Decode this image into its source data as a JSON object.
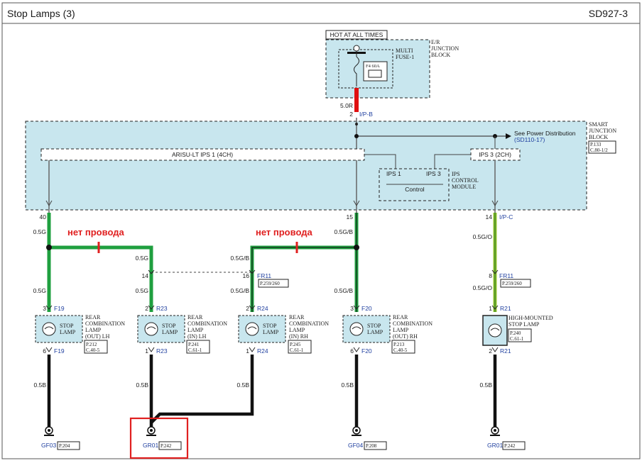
{
  "header": {
    "title": "Stop Lamps (3)",
    "code": "SD927-3"
  },
  "er_block": {
    "hot_label": "HOT AT ALL TIMES",
    "fuse_label_1": "MULTI",
    "fuse_label_2": "FUSE-1",
    "fuse_rating": "F4 60A",
    "name_1": "E/R",
    "name_2": "JUNCTION",
    "name_3": "BLOCK"
  },
  "feed": {
    "wire": "5.0R",
    "pin": "2",
    "conn": "I/P-B"
  },
  "sjb": {
    "name_1": "SMART",
    "name_2": "JUNCTION",
    "name_3": "BLOCK",
    "page_1": "P.133",
    "page_2": "C.80-1/2",
    "see_power": "See Power Distribution",
    "see_ref": "(SD110-17)",
    "ips1_4ch": "ARISU-LT IPS 1  (4CH)",
    "ips3_2ch": "IPS 3  (2CH)",
    "ips_1": "IPS 1",
    "ips_3": "IPS 3",
    "control": "Control",
    "module_1": "IPS",
    "module_2": "CONTROL",
    "module_3": "MODULE"
  },
  "wires": {
    "pin_40": "40",
    "w_05g": "0.5G",
    "pin_15": "15",
    "w_05gb": "0.5G/B",
    "pin_14": "14",
    "conn_ipc": "I/P-C",
    "w_05go": "0.5G/O",
    "jp_14": "14",
    "jp_16": "16",
    "fr11_a": "FR11",
    "fr11_a_page": "P.259/260",
    "w_05g_2": "0.5G",
    "w_05gb_2": "0.5G/B",
    "jp_8": "8",
    "fr11_b": "FR11",
    "fr11_b_page": "P.259/260",
    "w_05go_2": "0.5G/O",
    "w_05g_3": "0.5G",
    "w_05g_4": "0.5G",
    "w_05gb_3": "0.5G/B",
    "w_05gb_4": "0.5G/B",
    "no_wire_1": "нет провода",
    "no_wire_2": "нет провода"
  },
  "lamps": [
    {
      "pin_top": "3",
      "conn_top": "F19",
      "label_1": "STOP",
      "label_2": "LAMP",
      "name_1": "REAR",
      "name_2": "COMBINATION",
      "name_3": "LAMP",
      "name_4": "(OUT) LH",
      "page_1": "P.212",
      "page_2": "C.40-5",
      "pin_bot": "6",
      "conn_bot": "F19",
      "wire_bot": "0.5B"
    },
    {
      "pin_top": "2",
      "conn_top": "R23",
      "label_1": "STOP",
      "label_2": "LAMP",
      "name_1": "REAR",
      "name_2": "COMBINATION",
      "name_3": "LAMP",
      "name_4": "(IN) LH",
      "page_1": "P.241",
      "page_2": "C.61-1",
      "pin_bot": "1",
      "conn_bot": "R23",
      "wire_bot": "0.5B"
    },
    {
      "pin_top": "2",
      "conn_top": "R24",
      "label_1": "STOP",
      "label_2": "LAMP",
      "name_1": "REAR",
      "name_2": "COMBINATION",
      "name_3": "LAMP",
      "name_4": "(IN) RH",
      "page_1": "P.245",
      "page_2": "C.61-1",
      "pin_bot": "1",
      "conn_bot": "R24",
      "wire_bot": "0.5B"
    },
    {
      "pin_top": "3",
      "conn_top": "F20",
      "label_1": "STOP",
      "label_2": "LAMP",
      "name_1": "REAR",
      "name_2": "COMBINATION",
      "name_3": "LAMP",
      "name_4": "(OUT) RH",
      "page_1": "P.213",
      "page_2": "C.40-5",
      "pin_bot": "6",
      "conn_bot": "F20",
      "wire_bot": "0.5B"
    },
    {
      "pin_top": "1",
      "conn_top": "R21",
      "name_1": "HIGH-MOUNTED",
      "name_2": "STOP LAMP",
      "page_1": "P.240",
      "page_2": "C.61-1",
      "pin_bot": "2",
      "conn_bot": "R21",
      "wire_bot": "0.5B"
    }
  ],
  "grounds": [
    {
      "name": "GF03",
      "page": "P.204"
    },
    {
      "name": "GR01",
      "page": "P.242"
    },
    {
      "name": "GF04",
      "page": "P.208"
    },
    {
      "name": "GR01",
      "page": "P.242"
    }
  ]
}
